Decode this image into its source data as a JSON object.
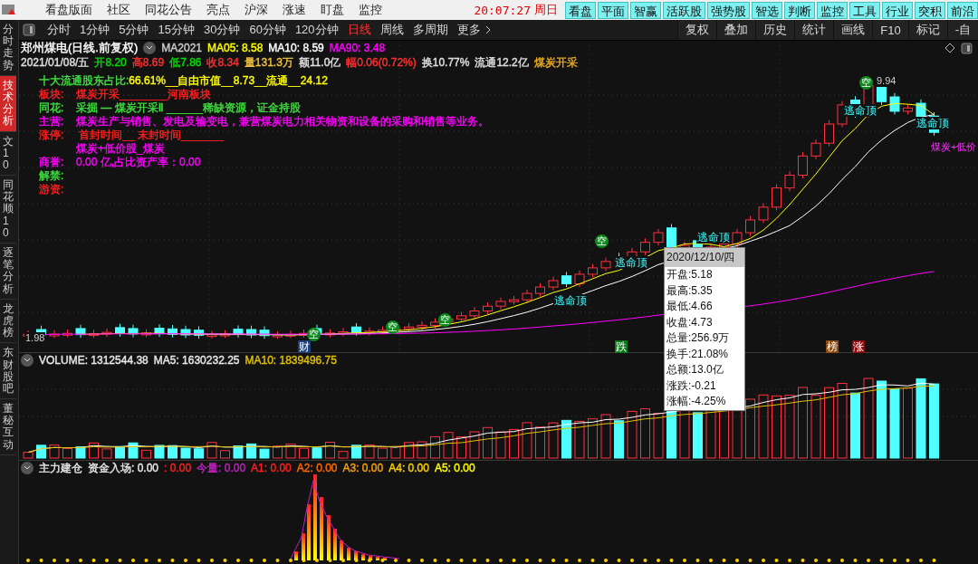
{
  "top_menu": [
    "看盘版面",
    "社区",
    "同花公告",
    "亮点",
    "沪深",
    "涨速",
    "盯盘",
    "监控"
  ],
  "clock": {
    "time": "20:07:27",
    "day": "周日"
  },
  "quick_buttons": [
    "看盘",
    "平面",
    "智赢",
    "活跃股",
    "强势股",
    "智选",
    "判断",
    "监控",
    "工具",
    "行业",
    "突积",
    "前沿"
  ],
  "period_tabs": [
    {
      "label": "分时",
      "selected": false
    },
    {
      "label": "1分钟",
      "selected": false
    },
    {
      "label": "5分钟",
      "selected": false
    },
    {
      "label": "15分钟",
      "selected": false
    },
    {
      "label": "30分钟",
      "selected": false
    },
    {
      "label": "60分钟",
      "selected": false
    },
    {
      "label": "120分钟",
      "selected": false
    },
    {
      "label": "日线",
      "selected": true
    },
    {
      "label": "周线",
      "selected": false
    },
    {
      "label": "多周期",
      "selected": false
    },
    {
      "label": "更多",
      "selected": false
    }
  ],
  "tools": [
    "复权",
    "叠加",
    "历史",
    "统计",
    "画线",
    "F10",
    "标记",
    "-自"
  ],
  "side_tabs": [
    {
      "label": "分时走势",
      "selected": false
    },
    {
      "label": "技术分析",
      "selected": true
    },
    {
      "label": "文10",
      "selected": false
    },
    {
      "label": "同花顺10",
      "selected": false
    },
    {
      "label": "逐笔分析",
      "selected": false
    },
    {
      "label": "龙虎榜",
      "selected": false
    },
    {
      "label": "东财股吧",
      "selected": false
    },
    {
      "label": "董秘互动",
      "selected": false
    }
  ],
  "stock": {
    "title": "郑州煤电(日线.前复权)",
    "formula": "MA2021",
    "ma": [
      {
        "label": "MA05: 8.58",
        "color": "#ffff00"
      },
      {
        "label": "MA10: 8.59",
        "color": "#ffffff"
      },
      {
        "label": "MA90: 3.48",
        "color": "#ff00ff"
      }
    ]
  },
  "quote": {
    "date": "2021/01/08/五",
    "fields": [
      {
        "text": "开8.20",
        "color": "#00e000"
      },
      {
        "text": "高8.69",
        "color": "#ff3030"
      },
      {
        "text": "低7.86",
        "color": "#00e000"
      },
      {
        "text": "收8.34",
        "color": "#ff3030"
      },
      {
        "text": "量131.3万",
        "color": "#f0c040"
      },
      {
        "text": "额11.0亿",
        "color": "#e0e0e0"
      },
      {
        "text": "幅0.06(0.72%)",
        "color": "#ff3030"
      },
      {
        "text": "换10.77%",
        "color": "#e0e0e0"
      },
      {
        "text": "流通12.2亿",
        "color": "#e0e0e0"
      },
      {
        "text": "煤炭开采",
        "color": "#f0b020"
      }
    ]
  },
  "info_lines": [
    {
      "label": {
        "text": "十大流通股东占比:",
        "color": "#40e040"
      },
      "value": {
        "text": "66.61%__自由市值__8.73__流通__24.12",
        "color": "#ffff00"
      }
    },
    {
      "label": {
        "text": "板块:",
        "color": "#ff2020"
      },
      "value": {
        "text": "煤炭开采________河南板块",
        "color": "#ff2020"
      }
    },
    {
      "label": {
        "text": "同花:",
        "color": "#40e040"
      },
      "value": {
        "text": "采掘 — 煤炭开采Ⅱ ______稀缺资源，证金持股",
        "color": "#40e040"
      }
    },
    {
      "label": {
        "text": "主营:",
        "color": "#ff00ff"
      },
      "value": {
        "text": "煤炭生产与销售、发电及输变电，兼营煤炭电力相关物资和设备的采购和销售等业务。",
        "color": "#ff00ff"
      }
    },
    {
      "label": {
        "text": "涨停:",
        "color": "#ff2020"
      },
      "value": {
        "text": " 首封时间__ 末封时间_______",
        "color": "#ff2020"
      }
    },
    {
      "value": {
        "text": "煤炭+低价股_煤炭",
        "color": "#ff00ff"
      }
    },
    {
      "label": {
        "text": "商誉:",
        "color": "#ff00ff"
      },
      "value": {
        "text": "0.00 亿,占比资产率：0.00",
        "color": "#ff00ff"
      }
    },
    {
      "label": {
        "text": "解禁:",
        "color": "#40e040"
      }
    },
    {
      "label": {
        "text": "游资:",
        "color": "#ff2020"
      }
    }
  ],
  "chart_marks": [
    {
      "kind": "signal",
      "text": "空"
    },
    {
      "kind": "signal",
      "text": "空"
    },
    {
      "kind": "signal",
      "text": "空"
    },
    {
      "kind": "signal",
      "text": "空"
    },
    {
      "kind": "signal",
      "text": "空"
    },
    {
      "kind": "warning",
      "text": "逃命顶"
    },
    {
      "kind": "warning",
      "text": "逃命顶"
    },
    {
      "kind": "warning",
      "text": "逃命顶"
    },
    {
      "kind": "warning",
      "text": "逃命顶"
    },
    {
      "kind": "warning",
      "text": "逃命顶"
    },
    {
      "kind": "price",
      "text": "9.94"
    },
    {
      "kind": "price",
      "text": "1.98"
    },
    {
      "kind": "note",
      "text": "煤炭+低价"
    },
    {
      "kind": "event",
      "text": "财",
      "color": "#1c3f7a"
    },
    {
      "kind": "event",
      "text": "跌",
      "color": "#0a7a1a"
    },
    {
      "kind": "event",
      "text": "榜",
      "color": "#8a4a10"
    },
    {
      "kind": "event",
      "text": "涨",
      "color": "#8a1010"
    }
  ],
  "tooltip": {
    "date": "2020/12/10/四",
    "lines": [
      "开盘:5.18",
      "最高:5.35",
      "最低:4.66",
      "收盘:4.73",
      "总量:256.9万",
      "换手:21.08%",
      "总额:13.0亿",
      "涨跌:-0.21",
      "涨幅:-4.25%"
    ]
  },
  "volume": {
    "fields": [
      {
        "text": "VOLUME: 1312544.38",
        "color": "#e8e8e8"
      },
      {
        "text": "MA5: 1630232.25",
        "color": "#e8e8e8"
      },
      {
        "text": "MA10: 1839496.75",
        "color": "#e0c000"
      }
    ]
  },
  "indicator": {
    "name": "主力建仓",
    "fields": [
      {
        "text": "资金入场: 0.00",
        "color": "#e8e8e8"
      },
      {
        "text": ": 0.00",
        "color": "#ff2020"
      },
      {
        "text": "今量: 0.00",
        "color": "#c020c0"
      },
      {
        "text": "A1: 0.00",
        "color": "#ff2020"
      },
      {
        "text": "A2: 0.00",
        "color": "#ff6a00"
      },
      {
        "text": "A3: 0.00",
        "color": "#ffa000"
      },
      {
        "text": "A4: 0.00",
        "color": "#ffd000"
      },
      {
        "text": "A5: 0.00",
        "color": "#ffff00"
      }
    ]
  }
}
